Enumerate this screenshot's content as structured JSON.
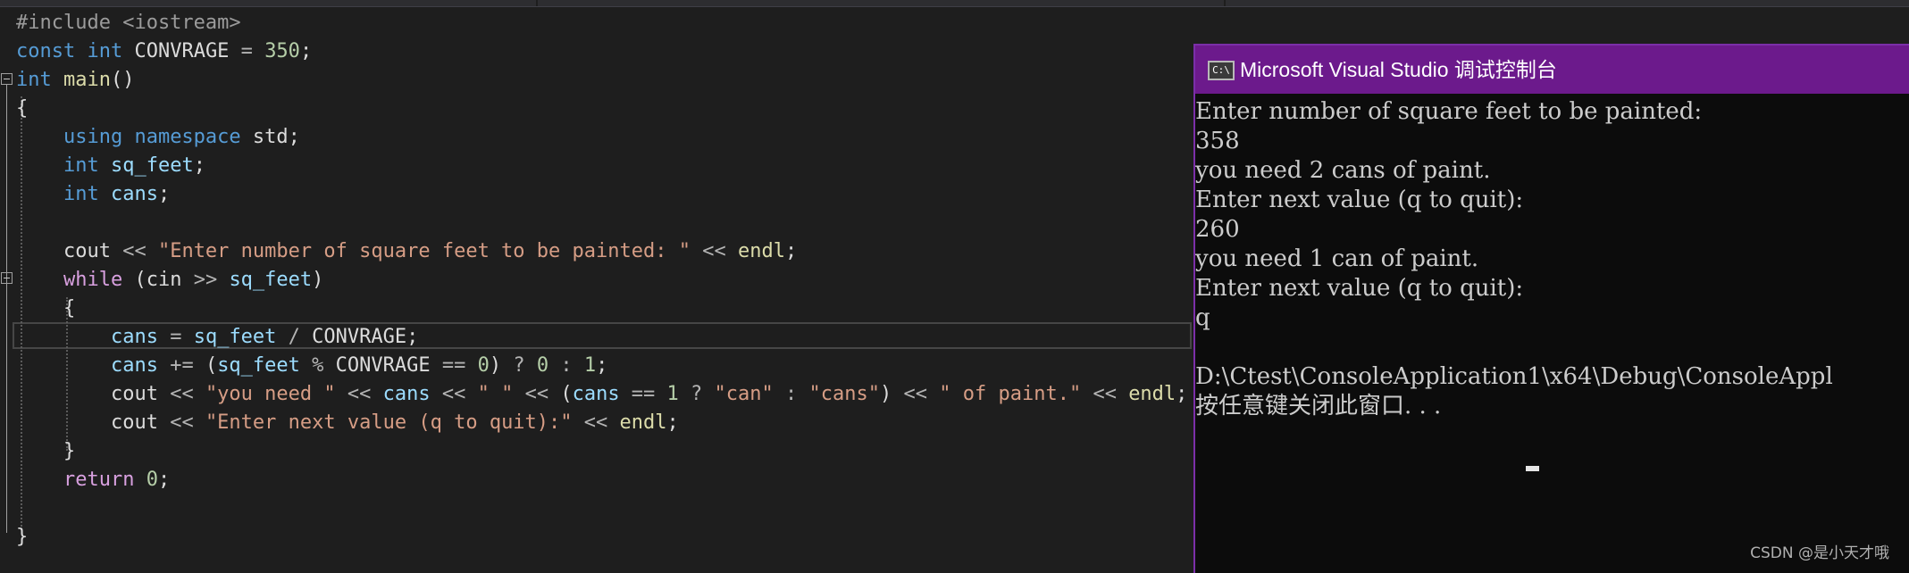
{
  "editor": {
    "lines": [
      [
        {
          "t": "#include <iostream>",
          "c": "pp"
        }
      ],
      [
        {
          "t": "const ",
          "c": "kw"
        },
        {
          "t": "int ",
          "c": "kw"
        },
        {
          "t": "CONVRAGE",
          "c": "plain"
        },
        {
          "t": " = ",
          "c": "op"
        },
        {
          "t": "350",
          "c": "num"
        },
        {
          "t": ";",
          "c": "plain"
        }
      ],
      [
        {
          "t": "int ",
          "c": "kw"
        },
        {
          "t": "main",
          "c": "fn"
        },
        {
          "t": "()",
          "c": "plain"
        }
      ],
      [
        {
          "t": "{",
          "c": "plain"
        }
      ],
      [
        {
          "t": "    using ",
          "c": "kw"
        },
        {
          "t": "namespace ",
          "c": "kw"
        },
        {
          "t": "std",
          "c": "plain"
        },
        {
          "t": ";",
          "c": "plain"
        }
      ],
      [
        {
          "t": "    int ",
          "c": "kw"
        },
        {
          "t": "sq_feet",
          "c": "var"
        },
        {
          "t": ";",
          "c": "plain"
        }
      ],
      [
        {
          "t": "    int ",
          "c": "kw"
        },
        {
          "t": "cans",
          "c": "var"
        },
        {
          "t": ";",
          "c": "plain"
        }
      ],
      [],
      [
        {
          "t": "    cout",
          "c": "plain"
        },
        {
          "t": " << ",
          "c": "op"
        },
        {
          "t": "\"Enter number of square feet to be painted: \"",
          "c": "str"
        },
        {
          "t": " << ",
          "c": "op"
        },
        {
          "t": "endl",
          "c": "fn"
        },
        {
          "t": ";",
          "c": "plain"
        }
      ],
      [
        {
          "t": "    while ",
          "c": "ctl"
        },
        {
          "t": "(",
          "c": "plain"
        },
        {
          "t": "cin",
          "c": "plain"
        },
        {
          "t": " >> ",
          "c": "op"
        },
        {
          "t": "sq_feet",
          "c": "var"
        },
        {
          "t": ")",
          "c": "plain"
        }
      ],
      [
        {
          "t": "    {",
          "c": "plain"
        }
      ],
      [
        {
          "t": "        cans",
          "c": "var"
        },
        {
          "t": " = ",
          "c": "op"
        },
        {
          "t": "sq_feet",
          "c": "var"
        },
        {
          "t": " / ",
          "c": "op"
        },
        {
          "t": "CONVRAGE",
          "c": "plain"
        },
        {
          "t": ";",
          "c": "plain"
        }
      ],
      [
        {
          "t": "        cans",
          "c": "var"
        },
        {
          "t": " += ",
          "c": "op"
        },
        {
          "t": "(",
          "c": "plain"
        },
        {
          "t": "sq_feet",
          "c": "var"
        },
        {
          "t": " % ",
          "c": "op"
        },
        {
          "t": "CONVRAGE",
          "c": "plain"
        },
        {
          "t": " == ",
          "c": "op"
        },
        {
          "t": "0",
          "c": "num"
        },
        {
          "t": ") ",
          "c": "plain"
        },
        {
          "t": "? ",
          "c": "op"
        },
        {
          "t": "0",
          "c": "num"
        },
        {
          "t": " : ",
          "c": "op"
        },
        {
          "t": "1",
          "c": "num"
        },
        {
          "t": ";",
          "c": "plain"
        }
      ],
      [
        {
          "t": "        cout",
          "c": "plain"
        },
        {
          "t": " << ",
          "c": "op"
        },
        {
          "t": "\"you need \"",
          "c": "str"
        },
        {
          "t": " << ",
          "c": "op"
        },
        {
          "t": "cans",
          "c": "var"
        },
        {
          "t": " << ",
          "c": "op"
        },
        {
          "t": "\" \"",
          "c": "str"
        },
        {
          "t": " << ",
          "c": "op"
        },
        {
          "t": "(",
          "c": "plain"
        },
        {
          "t": "cans",
          "c": "var"
        },
        {
          "t": " == ",
          "c": "op"
        },
        {
          "t": "1",
          "c": "num"
        },
        {
          "t": " ? ",
          "c": "op"
        },
        {
          "t": "\"can\"",
          "c": "str"
        },
        {
          "t": " : ",
          "c": "op"
        },
        {
          "t": "\"cans\"",
          "c": "str"
        },
        {
          "t": ")",
          "c": "plain"
        },
        {
          "t": " << ",
          "c": "op"
        },
        {
          "t": "\" of paint.\"",
          "c": "str"
        },
        {
          "t": " << ",
          "c": "op"
        },
        {
          "t": "endl",
          "c": "fn"
        },
        {
          "t": ";",
          "c": "plain"
        }
      ],
      [
        {
          "t": "        cout",
          "c": "plain"
        },
        {
          "t": " << ",
          "c": "op"
        },
        {
          "t": "\"Enter next value (q to quit):\"",
          "c": "str"
        },
        {
          "t": " << ",
          "c": "op"
        },
        {
          "t": "endl",
          "c": "fn"
        },
        {
          "t": ";",
          "c": "plain"
        }
      ],
      [
        {
          "t": "    }",
          "c": "plain"
        }
      ],
      [
        {
          "t": "    return ",
          "c": "ctl"
        },
        {
          "t": "0",
          "c": "num"
        },
        {
          "t": ";",
          "c": "plain"
        }
      ],
      [],
      [
        {
          "t": "}",
          "c": "plain"
        }
      ]
    ]
  },
  "console": {
    "title": "Microsoft Visual Studio 调试控制台",
    "icon_text": "C:\\",
    "icon": "console-app-icon",
    "accent": "#6c1a8c",
    "lines": [
      "Enter number of square feet to be painted:",
      "358",
      "you need 2 cans of paint.",
      "Enter next value (q to quit):",
      "260",
      "you need 1 can of paint.",
      "Enter next value (q to quit):",
      "q",
      "",
      "D:\\Ctest\\ConsoleApplication1\\x64\\Debug\\ConsoleAppl",
      "按任意键关闭此窗口. . ."
    ]
  },
  "watermark": "CSDN @是小天才哦"
}
